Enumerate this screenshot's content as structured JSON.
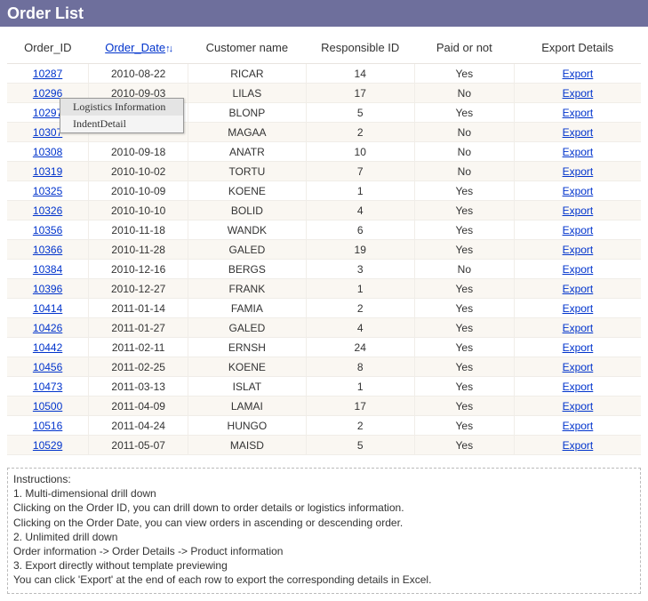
{
  "title": "Order List",
  "columns": {
    "order_id": "Order_ID",
    "order_date": "Order_Date",
    "customer": "Customer name",
    "responsible": "Responsible ID",
    "paid": "Paid or not",
    "export": "Export Details"
  },
  "sort_indicator": "↑↓",
  "export_label": "Export",
  "context_menu": {
    "item1": "Logistics Information",
    "item2": "IndentDetail"
  },
  "rows": [
    {
      "id": "10287",
      "date": "2010-08-22",
      "cust": "RICAR",
      "resp": "14",
      "paid": "Yes"
    },
    {
      "id": "10296",
      "date": "2010-09-03",
      "cust": "LILAS",
      "resp": "17",
      "paid": "No"
    },
    {
      "id": "10297",
      "date": "",
      "cust": "BLONP",
      "resp": "5",
      "paid": "Yes"
    },
    {
      "id": "10307",
      "date": "",
      "cust": "MAGAA",
      "resp": "2",
      "paid": "No"
    },
    {
      "id": "10308",
      "date": "2010-09-18",
      "cust": "ANATR",
      "resp": "10",
      "paid": "No"
    },
    {
      "id": "10319",
      "date": "2010-10-02",
      "cust": "TORTU",
      "resp": "7",
      "paid": "No"
    },
    {
      "id": "10325",
      "date": "2010-10-09",
      "cust": "KOENE",
      "resp": "1",
      "paid": "Yes"
    },
    {
      "id": "10326",
      "date": "2010-10-10",
      "cust": "BOLID",
      "resp": "4",
      "paid": "Yes"
    },
    {
      "id": "10356",
      "date": "2010-11-18",
      "cust": "WANDK",
      "resp": "6",
      "paid": "Yes"
    },
    {
      "id": "10366",
      "date": "2010-11-28",
      "cust": "GALED",
      "resp": "19",
      "paid": "Yes"
    },
    {
      "id": "10384",
      "date": "2010-12-16",
      "cust": "BERGS",
      "resp": "3",
      "paid": "No"
    },
    {
      "id": "10396",
      "date": "2010-12-27",
      "cust": "FRANK",
      "resp": "1",
      "paid": "Yes"
    },
    {
      "id": "10414",
      "date": "2011-01-14",
      "cust": "FAMIA",
      "resp": "2",
      "paid": "Yes"
    },
    {
      "id": "10426",
      "date": "2011-01-27",
      "cust": "GALED",
      "resp": "4",
      "paid": "Yes"
    },
    {
      "id": "10442",
      "date": "2011-02-11",
      "cust": "ERNSH",
      "resp": "24",
      "paid": "Yes"
    },
    {
      "id": "10456",
      "date": "2011-02-25",
      "cust": "KOENE",
      "resp": "8",
      "paid": "Yes"
    },
    {
      "id": "10473",
      "date": "2011-03-13",
      "cust": "ISLAT",
      "resp": "1",
      "paid": "Yes"
    },
    {
      "id": "10500",
      "date": "2011-04-09",
      "cust": "LAMAI",
      "resp": "17",
      "paid": "Yes"
    },
    {
      "id": "10516",
      "date": "2011-04-24",
      "cust": "HUNGO",
      "resp": "2",
      "paid": "Yes"
    },
    {
      "id": "10529",
      "date": "2011-05-07",
      "cust": "MAISD",
      "resp": "5",
      "paid": "Yes"
    }
  ],
  "instructions": {
    "l0": "Instructions:",
    "l1": "1. Multi-dimensional drill down",
    "l2": "Clicking on the Order ID, you can drill down to order details or logistics information.",
    "l3": "Clicking on the Order Date, you can view orders in ascending or descending order.",
    "l4": "2. Unlimited drill down",
    "l5": "Order information -> Order Details -> Product information",
    "l6": "3. Export directly without template previewing",
    "l7": "You can click 'Export' at the end of each row to export the corresponding details in Excel."
  }
}
